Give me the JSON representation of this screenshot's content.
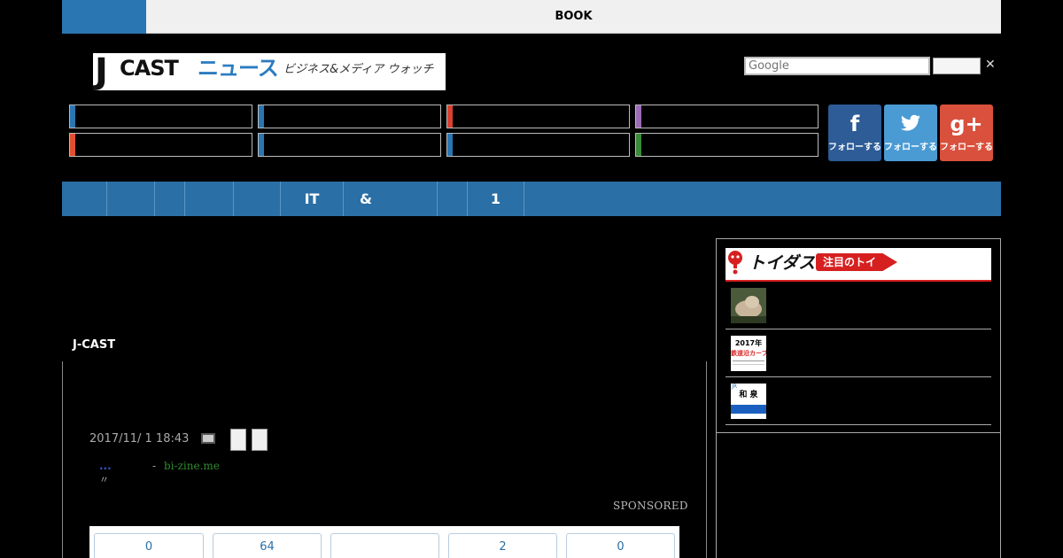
{
  "topbar": {
    "label": "BOOK"
  },
  "logo": {
    "j": "J",
    "cast": "CAST",
    "news": "ニュース",
    "sub": "ビジネス&メディア ウォッチ"
  },
  "search": {
    "placeholder": "Google",
    "close": "✕"
  },
  "colors": {
    "accent_blue": "#2a76b2",
    "nav_blue": "#2a6fa5",
    "category_bars": [
      "#2a76b2",
      "#2a76b2",
      "#d94030",
      "#9b6bb5",
      "#e05030",
      "#2a76b2",
      "#2a76b2",
      "#3a8a3a"
    ],
    "facebook": "#2d5c96",
    "twitter": "#4a9bd4",
    "googleplus": "#d9503c"
  },
  "social": [
    {
      "name": "facebook",
      "icon": "f",
      "label": "フォローする"
    },
    {
      "name": "twitter",
      "icon": "bird",
      "label": "フォローする"
    },
    {
      "name": "googleplus",
      "icon": "g+",
      "label": "フォローする"
    }
  ],
  "nav": {
    "items": [
      "",
      "",
      "",
      "",
      "",
      "IT",
      "&",
      "",
      "1",
      ""
    ]
  },
  "breadcrumb": "J-CAST",
  "article": {
    "timestamp": "2017/11/ 1 18:43",
    "ad_dots": "...",
    "ad_sep": "-",
    "ad_source": "bi-zine.me",
    "ad_quote": "〃",
    "sponsored": "SPONSORED",
    "counts": [
      "0",
      "64",
      "",
      "2",
      "0"
    ]
  },
  "sidebar": {
    "brand": "トイダス",
    "tag": "注目のトイ",
    "items": [
      {
        "thumb": "cat-photo"
      },
      {
        "thumb": "calendar-2017",
        "thumb_text": "2017年",
        "thumb_text2": "鉄道沿カーブ"
      },
      {
        "thumb": "station-sign",
        "thumb_text": "和 泉",
        "thumb_text2": "JR"
      }
    ]
  }
}
